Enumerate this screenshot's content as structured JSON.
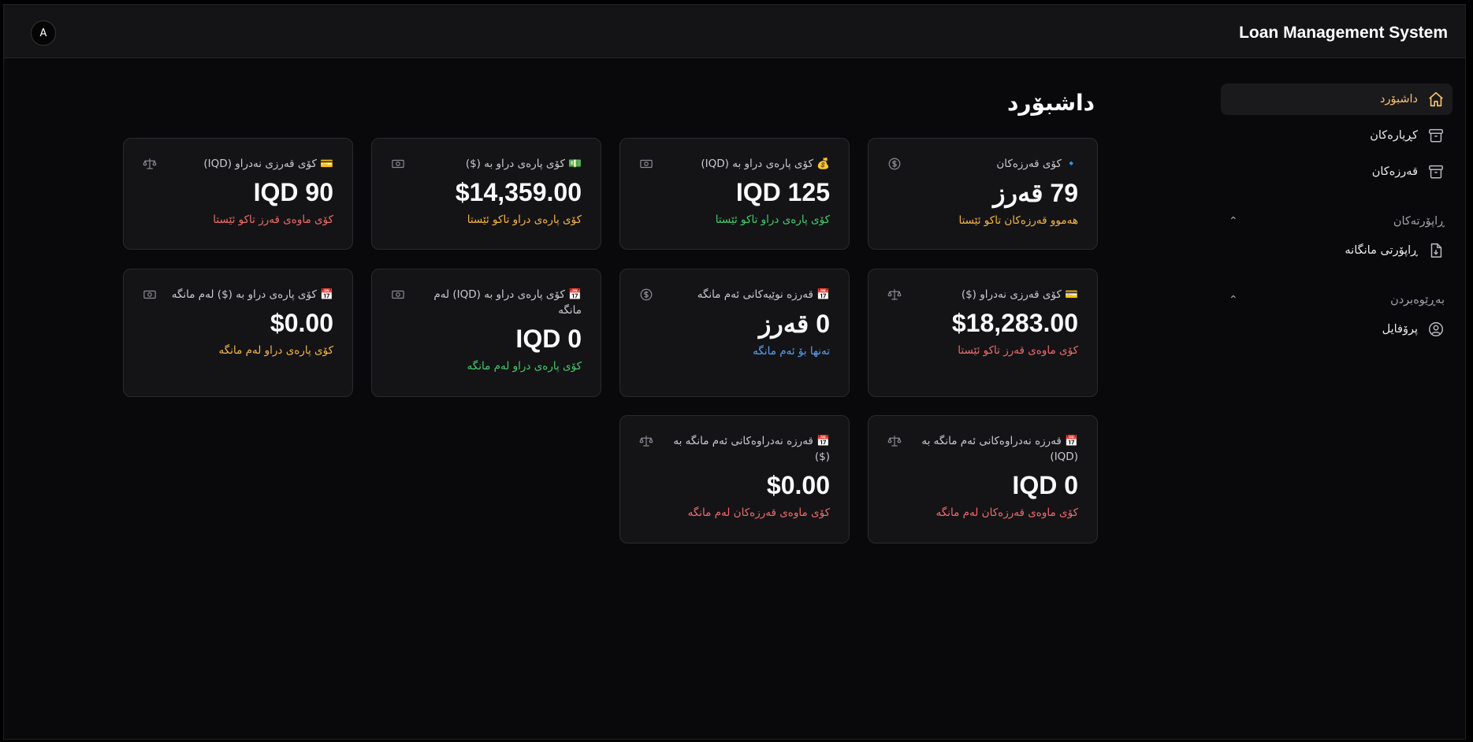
{
  "header": {
    "avatar_initial": "A",
    "app_title": "Loan Management System"
  },
  "page_title": "داشبۆرد",
  "sidebar": {
    "items": [
      {
        "label": "داشبۆرد",
        "icon": "home-icon",
        "active": true
      },
      {
        "label": "کڕیارەکان",
        "icon": "archive-icon"
      },
      {
        "label": "قەرزەکان",
        "icon": "archive-icon"
      }
    ],
    "groups": [
      {
        "label": "ڕاپۆرتەکان",
        "items": [
          {
            "label": "ڕاپۆرتی مانگانە",
            "icon": "file-download-icon"
          }
        ]
      },
      {
        "label": "بەڕێوەبردن",
        "items": [
          {
            "label": "پرۆفایل",
            "icon": "user-circle-icon"
          }
        ]
      }
    ]
  },
  "cards": [
    {
      "title": "🔹 کۆی قەرزەکان",
      "value": "79 قەرز",
      "sub": "هەموو قەرزەکان تاکو ئێستا",
      "icon": "dollar-circle-icon",
      "sub_color": "#f5b548"
    },
    {
      "title": "💰 کۆی پارەی دراو بە (IQD)",
      "value": "IQD 125",
      "sub": "کۆی پارەی دراو تاکو ئێستا",
      "icon": "money-bill-icon",
      "sub_color": "#46cc6c"
    },
    {
      "title": "💵 کۆی پارەی دراو بە ($)",
      "value": "$14,359.00",
      "sub": "کۆی پارەی دراو تاکو ئێستا",
      "icon": "money-bill-icon",
      "sub_color": "#f5b548"
    },
    {
      "title": "💳 کۆی قەرزی نەدراو (IQD)",
      "value": "IQD 90",
      "sub": "کۆی ماوەی قەرز تاکو ئێستا",
      "icon": "scale-icon",
      "sub_color": "#f06b6b"
    },
    {
      "title": "💳 کۆی قەرزی نەدراو ($)",
      "value": "$18,283.00",
      "sub": "کۆی ماوەی قەرز تاکو ئێستا",
      "icon": "scale-icon",
      "sub_color": "#f06b6b"
    },
    {
      "title": "📅 قەرزە نوێیەکانی ئەم مانگە",
      "value": "0 قەرز",
      "sub": "تەنها بۆ ئەم مانگە",
      "icon": "dollar-circle-icon",
      "sub_color": "#5aa2f0"
    },
    {
      "title": "📅 کۆی پارەی دراو بە (IQD) لەم مانگە",
      "value": "IQD 0",
      "sub": "کۆی پارەی دراو لەم مانگە",
      "icon": "money-bill-icon",
      "sub_color": "#46cc6c"
    },
    {
      "title": "📅 کۆی پارەی دراو بە ($) لەم مانگە",
      "value": "$0.00",
      "sub": "کۆی پارەی دراو لەم مانگە",
      "icon": "money-bill-icon",
      "sub_color": "#f5b548"
    },
    {
      "title": "📅 قەرزە نەدراوەکانی ئەم مانگە بە (IQD)",
      "value": "IQD 0",
      "sub": "کۆی ماوەی قەرزەکان لەم مانگە",
      "icon": "scale-icon",
      "sub_color": "#f06b6b"
    },
    {
      "title": "📅 قەرزە نەدراوەکانی ئەم مانگە بە ($)",
      "value": "$0.00",
      "sub": "کۆی ماوەی قەرزەکان لەم مانگە",
      "icon": "scale-icon",
      "sub_color": "#f06b6b"
    }
  ]
}
